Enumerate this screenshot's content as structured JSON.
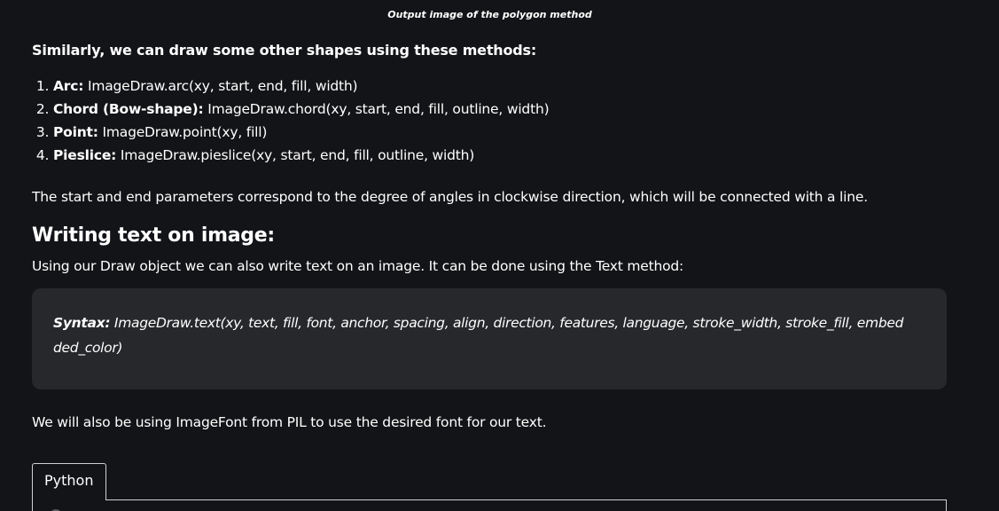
{
  "caption": "Output image of the polygon method",
  "lead": "Similarly, we can draw some other shapes using these methods:",
  "methods": [
    {
      "name": "Arc:",
      "signature": "ImageDraw.arc(xy, start, end, fill, width)"
    },
    {
      "name": "Chord (Bow-shape):",
      "signature": "ImageDraw.chord(xy, start, end, fill, outline, width)"
    },
    {
      "name": "Point:",
      "signature": "ImageDraw.point(xy, fill)"
    },
    {
      "name": "Pieslice:",
      "signature": "ImageDraw.pieslice(xy, start, end, fill, outline, width)"
    }
  ],
  "angles_note": "The start and end parameters correspond to the degree of angles in clockwise direction, which will be connected with a line.",
  "section_heading": "Writing text on image:",
  "text_intro": "Using our Draw object we can also write text on an image. It can be done using the Text method:",
  "syntax": {
    "label": "Syntax:",
    "line1": "ImageDraw.text(xy, text, fill, font, anchor, spacing, align, direction, features, language, stroke_width, stroke_fill, embed",
    "line2": "ded_color)"
  },
  "imagefont_note": "We will also be using ImageFont from PIL to use the desired font for our text.",
  "code_tab_label": "Python",
  "colors": {
    "background": "#131417",
    "box": "#27282c",
    "text": "#ffffff"
  }
}
